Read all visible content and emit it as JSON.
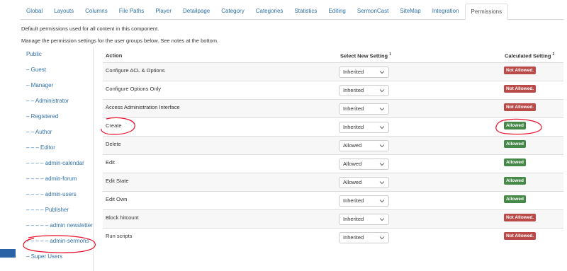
{
  "tabs": [
    "Global",
    "Layouts",
    "Columns",
    "File Paths",
    "Player",
    "Detailpage",
    "Category",
    "Categories",
    "Statistics",
    "Editing",
    "SermonCast",
    "SiteMap",
    "Integration",
    "Permissions"
  ],
  "active_tab": "Permissions",
  "intro": {
    "line1": "Default permissions used for all content in this component.",
    "line2": "Manage the permission settings for the user groups below. See notes at the bottom."
  },
  "groups": [
    "Public",
    "– Guest",
    "– Manager",
    "– – Administrator",
    "– Registered",
    "– – Author",
    "– – – Editor",
    "– – – – admin-calendar",
    "– – – – admin-forum",
    "– – – – admin-users",
    "– – – – Publisher",
    "– – – – – admin newsletter",
    "– – – – – admin-sermons",
    "– Super Users"
  ],
  "table": {
    "headers": {
      "action": "Action",
      "select": "Select New Setting",
      "select_sup": "1",
      "calculated": "Calculated Setting",
      "calculated_sup": "2"
    },
    "rows": [
      {
        "action": "Configure ACL & Options",
        "setting": "Inherited",
        "calculated": "Not Allowed."
      },
      {
        "action": "Configure Options Only",
        "setting": "Inherited",
        "calculated": "Not Allowed."
      },
      {
        "action": "Access Administration Interface",
        "setting": "Inherited",
        "calculated": "Not Allowed."
      },
      {
        "action": "Create",
        "setting": "Inherited",
        "calculated": "Allowed"
      },
      {
        "action": "Delete",
        "setting": "Allowed",
        "calculated": "Allowed"
      },
      {
        "action": "Edit",
        "setting": "Allowed",
        "calculated": "Allowed"
      },
      {
        "action": "Edit State",
        "setting": "Allowed",
        "calculated": "Allowed"
      },
      {
        "action": "Edit Own",
        "setting": "Inherited",
        "calculated": "Allowed"
      },
      {
        "action": "Block hitcount",
        "setting": "Inherited",
        "calculated": "Not Allowed."
      },
      {
        "action": "Run scripts",
        "setting": "Inherited",
        "calculated": "Not Allowed."
      }
    ]
  },
  "icons": {
    "select_arrow": "chevron-down-icon"
  },
  "colors": {
    "link": "#3071a9",
    "not_allowed": "#b94a48",
    "allowed": "#468847",
    "annotation": "#e8112d"
  }
}
